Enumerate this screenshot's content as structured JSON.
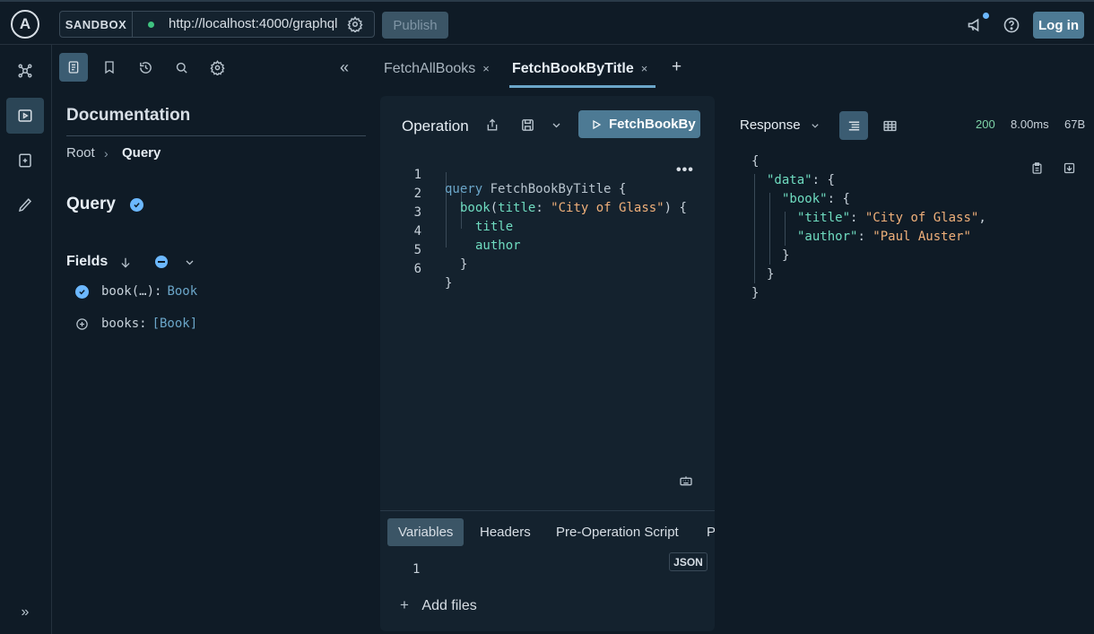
{
  "topbar": {
    "logo_letter": "A",
    "env_label": "SANDBOX",
    "url": "http://localhost:4000/graphql",
    "publish_label": "Publish",
    "login_label": "Log in",
    "icons": [
      "settings-icon",
      "announcement-icon",
      "help-icon"
    ]
  },
  "left_rail": {
    "items": [
      "schema-icon",
      "explorer-icon",
      "checks-icon",
      "launches-icon"
    ],
    "expand_icon": "expand-icon"
  },
  "docs": {
    "toolbar_icons": [
      "documentation-icon",
      "bookmark-icon",
      "history-icon",
      "search-icon",
      "settings-icon",
      "collapse-icon"
    ],
    "title": "Documentation",
    "breadcrumb_root": "Root",
    "breadcrumb_sep": "›",
    "breadcrumb_current": "Query",
    "type_name": "Query",
    "fields_label": "Fields",
    "fields": [
      {
        "name": "book(…):",
        "type": "Book",
        "selected": true
      },
      {
        "name": "books:",
        "type": "[Book]",
        "selected": false
      }
    ]
  },
  "tabs": [
    {
      "label": "FetchAllBooks",
      "active": false
    },
    {
      "label": "FetchBookByTitle",
      "active": true
    }
  ],
  "tab_close": "×",
  "tab_add": "+",
  "operation": {
    "label": "Operation",
    "run_label": "FetchBookBy",
    "line_numbers": [
      "1",
      "2",
      "3",
      "4",
      "5",
      "6"
    ],
    "code": {
      "l1_kw": "query",
      "l1_name": " FetchBookByTitle ",
      "l1_brace": "{",
      "l2_field": "book",
      "l2_open": "(",
      "l2_arg": "title",
      "l2_colon": ": ",
      "l2_str": "\"City of Glass\"",
      "l2_close": ") {",
      "l3_field": "title",
      "l4_field": "author",
      "l5_brace": "}",
      "l6_brace": "}"
    },
    "more_label": "•••"
  },
  "bottom": {
    "tabs": [
      "Variables",
      "Headers",
      "Pre-Operation Script",
      "P"
    ],
    "active_tab": "Variables",
    "json_label": "JSON",
    "var_line": "1",
    "add_files_plus": "+",
    "add_files_label": "Add files"
  },
  "response": {
    "label": "Response",
    "status_code": "200",
    "time": "8.00ms",
    "size": "67B",
    "status_color": "#7fd4a8",
    "json": {
      "open": "{",
      "data_key": "\"data\"",
      "book_key": "\"book\"",
      "title_key": "\"title\"",
      "title_val": "\"City of Glass\"",
      "author_key": "\"author\"",
      "author_val": "\"Paul Auster\"",
      "colon": ": ",
      "obj_open": "{",
      "comma": ",",
      "close": "}"
    }
  }
}
